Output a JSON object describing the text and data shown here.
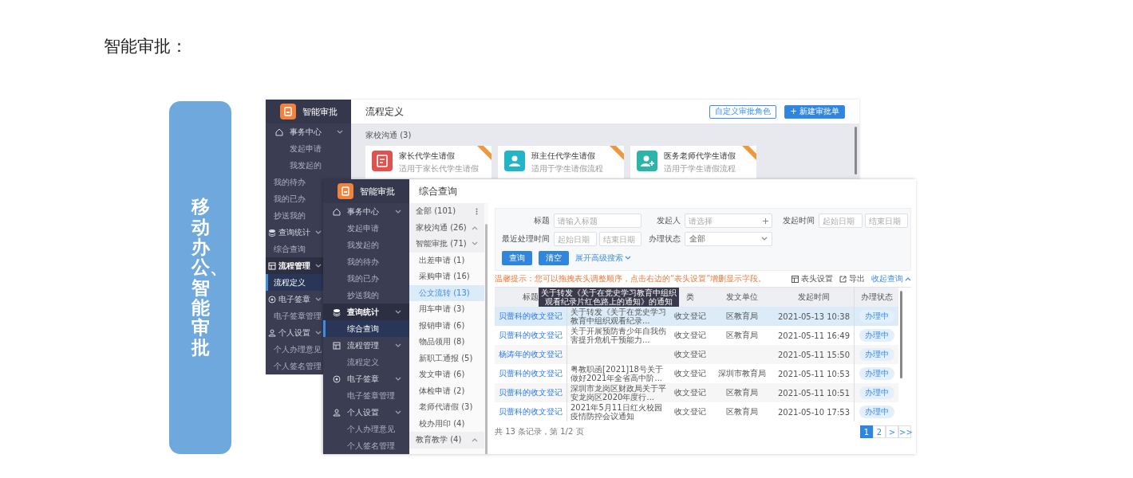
{
  "heading": "智能审批：",
  "banner": {
    "text": "移动办公、智能审批"
  },
  "window_a": {
    "sidebar": {
      "title": "智能审批",
      "groups": [
        {
          "label": "事务中心",
          "expanded": true,
          "active": false,
          "children": [
            {
              "label": "发起申请",
              "selected": false
            },
            {
              "label": "我发起的",
              "selected": false
            },
            {
              "label": "我的待办",
              "selected": false
            },
            {
              "label": "我的已办",
              "selected": false
            },
            {
              "label": "抄送我的",
              "selected": false
            }
          ]
        },
        {
          "label": "查询统计",
          "expanded": true,
          "active": false,
          "children": [
            {
              "label": "综合查询",
              "selected": false
            }
          ]
        },
        {
          "label": "流程管理",
          "expanded": true,
          "active": true,
          "children": [
            {
              "label": "流程定义",
              "selected": true
            }
          ]
        },
        {
          "label": "电子签章",
          "expanded": true,
          "active": false,
          "children": [
            {
              "label": "电子签章管理",
              "selected": false
            }
          ]
        },
        {
          "label": "个人设置",
          "expanded": true,
          "active": false,
          "children": [
            {
              "label": "个人办理意见",
              "selected": false
            },
            {
              "label": "个人签名管理",
              "selected": false
            }
          ]
        }
      ]
    },
    "title": "流程定义",
    "buttons": [
      {
        "label": "自定义审批角色",
        "kind": "outline"
      },
      {
        "label": "+ 新建审批单",
        "kind": "primary"
      }
    ],
    "group_label": "家校沟通 (3)",
    "cards": [
      {
        "title": "家长代学生请假",
        "description": "适用于家长代学生请假",
        "color": "#e0524f"
      },
      {
        "title": "班主任代学生请假",
        "description": "适用于学生请假流程",
        "color": "#22b5c6"
      },
      {
        "title": "医务老师代学生请假",
        "description": "适用于学生请假流程",
        "color": "#2bb5a8"
      }
    ]
  },
  "window_b": {
    "sidebar": {
      "title": "智能审批",
      "groups": [
        {
          "label": "事务中心",
          "expanded": true,
          "active": false,
          "children": [
            {
              "label": "发起申请",
              "selected": false
            },
            {
              "label": "我发起的",
              "selected": false
            },
            {
              "label": "我的待办",
              "selected": false
            },
            {
              "label": "我的已办",
              "selected": false
            },
            {
              "label": "抄送我的",
              "selected": false
            }
          ]
        },
        {
          "label": "查询统计",
          "expanded": true,
          "active": true,
          "children": [
            {
              "label": "综合查询",
              "selected": true
            }
          ]
        },
        {
          "label": "流程管理",
          "expanded": true,
          "active": false,
          "children": [
            {
              "label": "流程定义",
              "selected": false
            }
          ]
        },
        {
          "label": "电子签章",
          "expanded": true,
          "active": false,
          "children": [
            {
              "label": "电子签章管理",
              "selected": false
            }
          ]
        },
        {
          "label": "个人设置",
          "expanded": true,
          "active": false,
          "children": [
            {
              "label": "个人办理意见",
              "selected": false
            },
            {
              "label": "个人签名管理",
              "selected": false
            }
          ]
        }
      ]
    },
    "title": "综合查询",
    "categories": [
      {
        "label": "全部 (101)",
        "kind": "all"
      },
      {
        "label": "家校沟通 (26)",
        "kind": "group",
        "expanded": false
      },
      {
        "label": "智能审批 (71)",
        "kind": "group",
        "expanded": true,
        "children": [
          {
            "label": "出差申请 (1)",
            "selected": false
          },
          {
            "label": "采购申请 (16)",
            "selected": false
          },
          {
            "label": "公文流转 (13)",
            "selected": true
          },
          {
            "label": "用车申请 (3)",
            "selected": false
          },
          {
            "label": "报销申请 (6)",
            "selected": false
          },
          {
            "label": "物品领用 (8)",
            "selected": false
          },
          {
            "label": "新职工通报 (5)",
            "selected": false
          },
          {
            "label": "发文申请 (6)",
            "selected": false
          },
          {
            "label": "体检申请 (2)",
            "selected": false
          },
          {
            "label": "老师代请假 (3)",
            "selected": false
          },
          {
            "label": "校办用印 (4)",
            "selected": false
          }
        ]
      },
      {
        "label": "教育教学 (4)",
        "kind": "group",
        "expanded": false
      }
    ],
    "filters": {
      "title_label": "标题",
      "title_placeholder": "请输入标题",
      "initiator_label": "发起人",
      "initiator_placeholder": "请选择",
      "start_label": "发起时间",
      "start_from_placeholder": "起始日期",
      "start_to_placeholder": "结束日期",
      "recent_label": "最近处理时间",
      "recent_from_placeholder": "起始日期",
      "recent_to_placeholder": "结束日期",
      "status_label": "办理状态",
      "status_value": "全部"
    },
    "actions": {
      "search": "查询",
      "clear": "清空",
      "advanced": "展开高级搜索"
    },
    "hint": "温馨提示：您可以拖拽表头调整顺序，点击右边的“表头设置”增删显示字段。",
    "tools": {
      "columns": "表头设置",
      "export": "导出",
      "collapse": "收起查询"
    },
    "tooltip": "关于转发《关于在党史学习教育中组织观看纪录片红色路上的通知》的通知",
    "columns": [
      "标题",
      null,
      "类",
      "发文单位",
      "发起时间",
      "办理状态"
    ],
    "rows": [
      {
        "cells": [
          "贝蕾科的收文登记",
          "关于转发《关于在党史学习教育中组织观看纪录...",
          "收文登记",
          "区教育局",
          "2021-05-13 10:38",
          "办理中"
        ],
        "selected": true
      },
      {
        "cells": [
          "贝蕾科的收文登记",
          "关于开展预防青少年自我伤害提升危机干预能力...",
          "收文登记",
          "区教育局",
          "2021-05-11 16:49",
          "办理中"
        ],
        "selected": false
      },
      {
        "cells": [
          "杨涛年的收文登记",
          null,
          "收文登记",
          null,
          "2021-05-11 15:50",
          "办理中"
        ],
        "selected": false
      },
      {
        "cells": [
          "贝蕾科的收文登记",
          "粤教职函[2021]18号关于做好2021年全省高中阶...",
          "收文登记",
          "深圳市教育局",
          "2021-05-11 10:53",
          "办理中"
        ],
        "selected": false
      },
      {
        "cells": [
          "贝蕾科的收文登记",
          "深圳市龙岗区财政局关于平安龙岗区2020年度行...",
          "收文登记",
          "区教育局",
          "2021-05-11 10:51",
          "办理中"
        ],
        "selected": false
      },
      {
        "cells": [
          "贝蕾科的收文登记",
          "2021年5月11日红火校园疫情防控会议通知",
          "收文登记",
          "区教育局",
          "2021-05-10 17:53",
          "办理中"
        ],
        "selected": false
      }
    ],
    "summary": "共 13 条记录，第 1/2 页",
    "pages": [
      {
        "label": "1",
        "selected": true
      },
      {
        "label": "2",
        "selected": false
      },
      {
        "label": ">",
        "selected": false
      },
      {
        "label": ">>",
        "selected": false
      }
    ]
  }
}
